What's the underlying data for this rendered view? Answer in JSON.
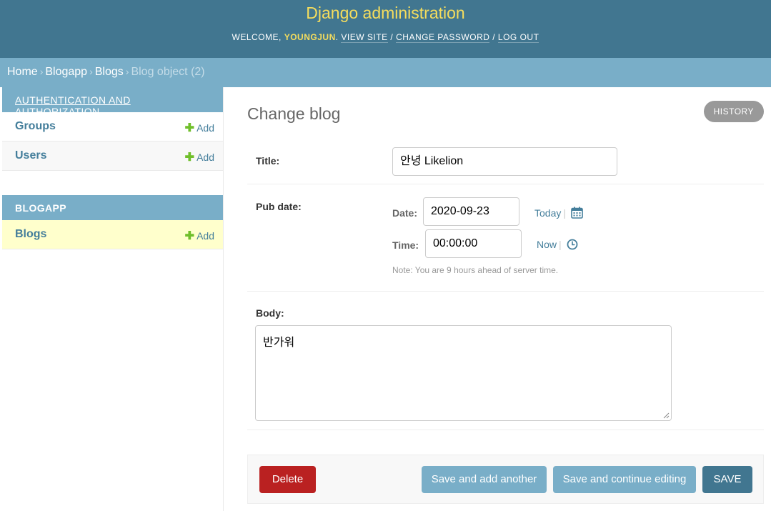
{
  "header": {
    "site_name": "Django administration",
    "welcome": "Welcome, ",
    "username": "youngjun",
    "view_site": "View site",
    "change_password": "Change password",
    "log_out": "Log out"
  },
  "breadcrumbs": {
    "home": "Home",
    "app": "Blogapp",
    "model": "Blogs",
    "current": "Blog object (2)",
    "separator": "›"
  },
  "sidebar": {
    "modules": [
      {
        "caption": "Authentication and Authorization",
        "models": [
          {
            "name": "Groups",
            "add": "Add"
          },
          {
            "name": "Users",
            "add": "Add"
          }
        ]
      },
      {
        "caption": "Blogapp",
        "models": [
          {
            "name": "Blogs",
            "add": "Add"
          }
        ]
      }
    ]
  },
  "content": {
    "title": "Change blog",
    "history": "History",
    "fields": {
      "title_label": "Title:",
      "title_value": "안녕 Likelion",
      "pub_date_label": "Pub date:",
      "date_label": "Date:",
      "date_value": "2020-09-23",
      "today": "Today",
      "time_label": "Time:",
      "time_value": "00:00:00",
      "now": "Now",
      "tz_note": "Note: You are 9 hours ahead of server time.",
      "body_label": "Body:",
      "body_value": "반가워"
    },
    "buttons": {
      "delete": "Delete",
      "save_add_another": "Save and add another",
      "save_continue": "Save and continue editing",
      "save": "Save"
    }
  },
  "colors": {
    "header_bg": "#417690",
    "breadcrumb_bg": "#79aec8",
    "site_name": "#f5dd5d",
    "link": "#447e9b",
    "add_plus": "#70bf2b",
    "delete": "#ba2121",
    "selected_row": "#ffffcc"
  }
}
